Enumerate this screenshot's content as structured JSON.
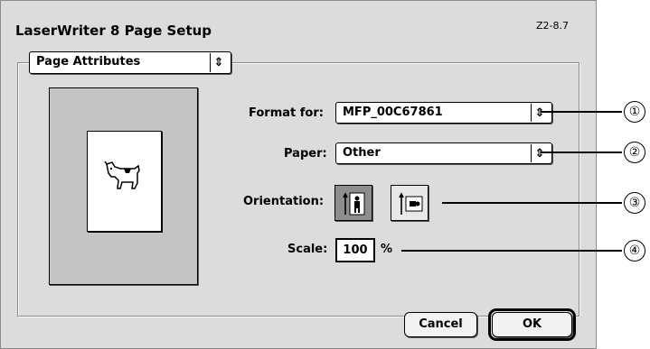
{
  "window": {
    "title": "LaserWriter 8 Page Setup",
    "version": "Z2-8.7"
  },
  "section": {
    "selected": "Page Attributes",
    "arrow": "⇕"
  },
  "format_for": {
    "label": "Format for:",
    "value": "MFP_00C67861",
    "arrow": "⇕"
  },
  "paper": {
    "label": "Paper:",
    "value": "Other",
    "arrow": "⇕"
  },
  "orientation": {
    "label": "Orientation:",
    "options": [
      "portrait-icon",
      "landscape-icon"
    ],
    "selected": "portrait"
  },
  "scale": {
    "label": "Scale:",
    "value": "100",
    "unit": "%"
  },
  "buttons": {
    "cancel": "Cancel",
    "ok": "OK"
  },
  "callouts": [
    "①",
    "②",
    "③",
    "④"
  ]
}
